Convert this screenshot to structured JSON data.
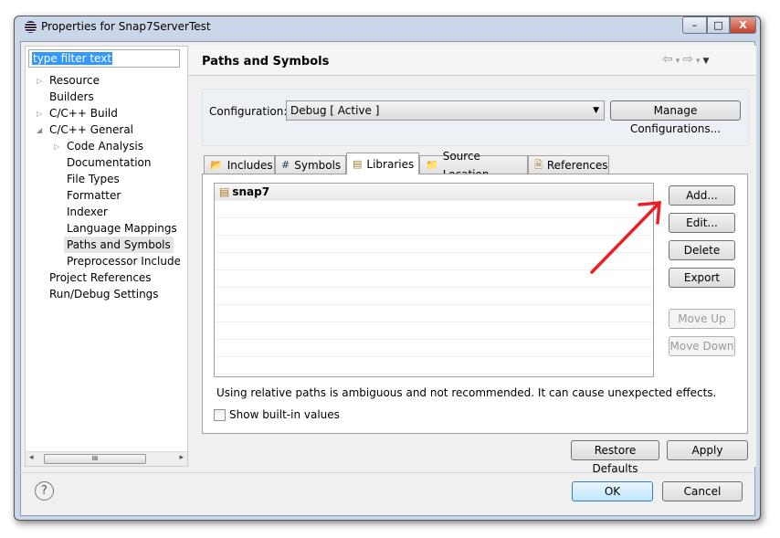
{
  "window": {
    "title": "Properties for Snap7ServerTest",
    "min": "–",
    "max": "□",
    "close": "X"
  },
  "filter": {
    "value": "type filter text"
  },
  "tree": [
    {
      "label": "Resource",
      "indent": 0,
      "twisty": "▷"
    },
    {
      "label": "Builders",
      "indent": 0,
      "twisty": ""
    },
    {
      "label": "C/C++ Build",
      "indent": 0,
      "twisty": "▷"
    },
    {
      "label": "C/C++ General",
      "indent": 0,
      "twisty": "◢"
    },
    {
      "label": "Code Analysis",
      "indent": 1,
      "twisty": "▷"
    },
    {
      "label": "Documentation",
      "indent": 1,
      "twisty": ""
    },
    {
      "label": "File Types",
      "indent": 1,
      "twisty": ""
    },
    {
      "label": "Formatter",
      "indent": 1,
      "twisty": ""
    },
    {
      "label": "Indexer",
      "indent": 1,
      "twisty": ""
    },
    {
      "label": "Language Mappings",
      "indent": 1,
      "twisty": ""
    },
    {
      "label": "Paths and Symbols",
      "indent": 1,
      "twisty": "",
      "selected": true
    },
    {
      "label": "Preprocessor Include Pa",
      "indent": 1,
      "twisty": ""
    },
    {
      "label": "Project References",
      "indent": 0,
      "twisty": ""
    },
    {
      "label": "Run/Debug Settings",
      "indent": 0,
      "twisty": ""
    }
  ],
  "scroll": {
    "left": "◂",
    "right": "▸",
    "grip": "III"
  },
  "page": {
    "title": "Paths and Symbols",
    "nav": [
      "⇦",
      "▾",
      "⇨",
      "▾",
      "▼"
    ]
  },
  "config": {
    "label": "Configuration:",
    "value": "Debug  [ Active ]",
    "manage": "Manage Configurations..."
  },
  "tabs": [
    {
      "label": "Includes",
      "icon": "📂"
    },
    {
      "label": "Symbols",
      "icon": "#"
    },
    {
      "label": "Libraries",
      "icon": "▤",
      "active": true
    },
    {
      "label": "Source Location",
      "icon": "📁"
    },
    {
      "label": "References",
      "icon": "🗎"
    }
  ],
  "libraries": [
    "snap7"
  ],
  "buttons": {
    "add": "Add...",
    "edit": "Edit...",
    "delete": "Delete",
    "export": "Export",
    "move_up": "Move Up",
    "move_down": "Move Down"
  },
  "warning": "Using relative paths is ambiguous and not recommended. It can cause unexpected effects.",
  "show_builtin": {
    "label": "Show built-in values",
    "checked": false
  },
  "restore": "Restore Defaults",
  "apply": "Apply",
  "ok": "OK",
  "cancel": "Cancel",
  "help": "?",
  "colors": {
    "annotation_arrow": "#ee1c24",
    "selection": "#3399ff"
  }
}
